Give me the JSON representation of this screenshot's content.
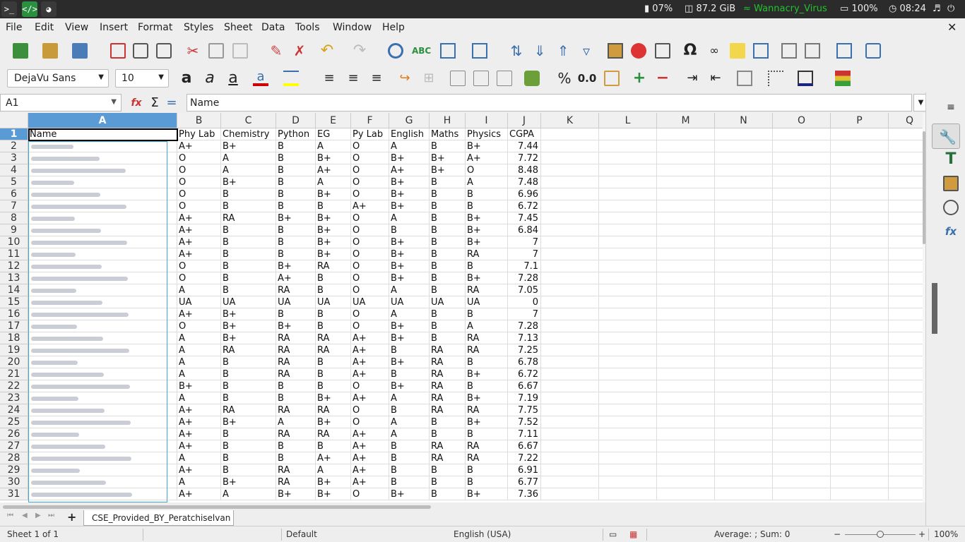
{
  "topbar": {
    "battery": "07%",
    "disk": "87.2 GiB",
    "wifi": "Wannacry_Virus",
    "power": "100%",
    "time": "08:24"
  },
  "menus": [
    "File",
    "Edit",
    "View",
    "Insert",
    "Format",
    "Styles",
    "Sheet",
    "Data",
    "Tools",
    "Window",
    "Help"
  ],
  "formatting": {
    "font_name": "DejaVu Sans",
    "font_size": "10",
    "percent": "%",
    "decimal": "0.0"
  },
  "formula_bar": {
    "name_box": "A1",
    "content": "Name"
  },
  "columns": [
    "A",
    "B",
    "C",
    "D",
    "E",
    "F",
    "G",
    "H",
    "I",
    "J",
    "K",
    "L",
    "M",
    "N",
    "O",
    "P",
    "Q"
  ],
  "header_row": [
    "Name",
    "Phy Lab",
    "Chemistry",
    "Python",
    "EG",
    "Py Lab",
    "English",
    "Maths",
    "Physics",
    "CGPA"
  ],
  "rows": [
    [
      "A+",
      "B+",
      "B",
      "A",
      "O",
      "A",
      "B",
      "B+",
      "7.44"
    ],
    [
      "O",
      "A",
      "B",
      "B+",
      "O",
      "B+",
      "B+",
      "A+",
      "7.72"
    ],
    [
      "O",
      "A",
      "B",
      "A+",
      "O",
      "A+",
      "B+",
      "O",
      "8.48"
    ],
    [
      "O",
      "B+",
      "B",
      "A",
      "O",
      "B+",
      "B",
      "A",
      "7.48"
    ],
    [
      "O",
      "B",
      "B",
      "B+",
      "O",
      "B+",
      "B",
      "B",
      "6.96"
    ],
    [
      "O",
      "B",
      "B",
      "B",
      "A+",
      "B+",
      "B",
      "B",
      "6.72"
    ],
    [
      "A+",
      "RA",
      "B+",
      "B+",
      "O",
      "A",
      "B",
      "B+",
      "7.45"
    ],
    [
      "A+",
      "B",
      "B",
      "B+",
      "O",
      "B",
      "B",
      "B+",
      "6.84"
    ],
    [
      "A+",
      "B",
      "B",
      "B+",
      "O",
      "B+",
      "B",
      "B+",
      "7"
    ],
    [
      "A+",
      "B",
      "B",
      "B+",
      "O",
      "B+",
      "B",
      "RA",
      "7"
    ],
    [
      "O",
      "B",
      "B+",
      "RA",
      "O",
      "B+",
      "B",
      "B",
      "7.1"
    ],
    [
      "O",
      "B",
      "A+",
      "B",
      "O",
      "B+",
      "B",
      "B+",
      "7.28"
    ],
    [
      "A",
      "B",
      "RA",
      "B",
      "O",
      "A",
      "B",
      "RA",
      "7.05"
    ],
    [
      "UA",
      "UA",
      "UA",
      "UA",
      "UA",
      "UA",
      "UA",
      "UA",
      "0"
    ],
    [
      "A+",
      "B+",
      "B",
      "B",
      "O",
      "A",
      "B",
      "B",
      "7"
    ],
    [
      "O",
      "B+",
      "B+",
      "B",
      "O",
      "B+",
      "B",
      "A",
      "7.28"
    ],
    [
      "A",
      "B+",
      "RA",
      "RA",
      "A+",
      "B+",
      "B",
      "RA",
      "7.13"
    ],
    [
      "A",
      "RA",
      "RA",
      "RA",
      "A+",
      "B",
      "RA",
      "RA",
      "7.25"
    ],
    [
      "A",
      "B",
      "RA",
      "B",
      "A+",
      "B+",
      "RA",
      "B",
      "6.78"
    ],
    [
      "A",
      "B",
      "RA",
      "B",
      "A+",
      "B",
      "RA",
      "B+",
      "6.72"
    ],
    [
      "B+",
      "B",
      "B",
      "B",
      "O",
      "B+",
      "RA",
      "B",
      "6.67"
    ],
    [
      "A",
      "B",
      "B",
      "B+",
      "A+",
      "A",
      "RA",
      "B+",
      "7.19"
    ],
    [
      "A+",
      "RA",
      "RA",
      "RA",
      "O",
      "B",
      "RA",
      "RA",
      "7.75"
    ],
    [
      "A+",
      "B+",
      "A",
      "B+",
      "O",
      "A",
      "B",
      "B+",
      "7.52"
    ],
    [
      "A+",
      "B",
      "RA",
      "RA",
      "A+",
      "A",
      "B",
      "B",
      "7.11"
    ],
    [
      "A+",
      "B",
      "B",
      "B",
      "A+",
      "B",
      "RA",
      "RA",
      "6.67"
    ],
    [
      "A",
      "B",
      "B",
      "A+",
      "A+",
      "B",
      "RA",
      "RA",
      "7.22"
    ],
    [
      "A+",
      "B",
      "RA",
      "A",
      "A+",
      "B",
      "B",
      "B",
      "6.91"
    ],
    [
      "A",
      "B+",
      "RA",
      "B+",
      "A+",
      "B",
      "B",
      "B",
      "6.77"
    ],
    [
      "A+",
      "A",
      "B+",
      "B+",
      "O",
      "B+",
      "B",
      "B+",
      "7.36"
    ]
  ],
  "sheet_tab": "CSE_Provided_BY_Peratchiselvan",
  "statusbar": {
    "sheet": "Sheet 1 of 1",
    "style": "Default",
    "language": "English (USA)",
    "summary": "Average: ; Sum: 0",
    "zoom": "100%"
  }
}
